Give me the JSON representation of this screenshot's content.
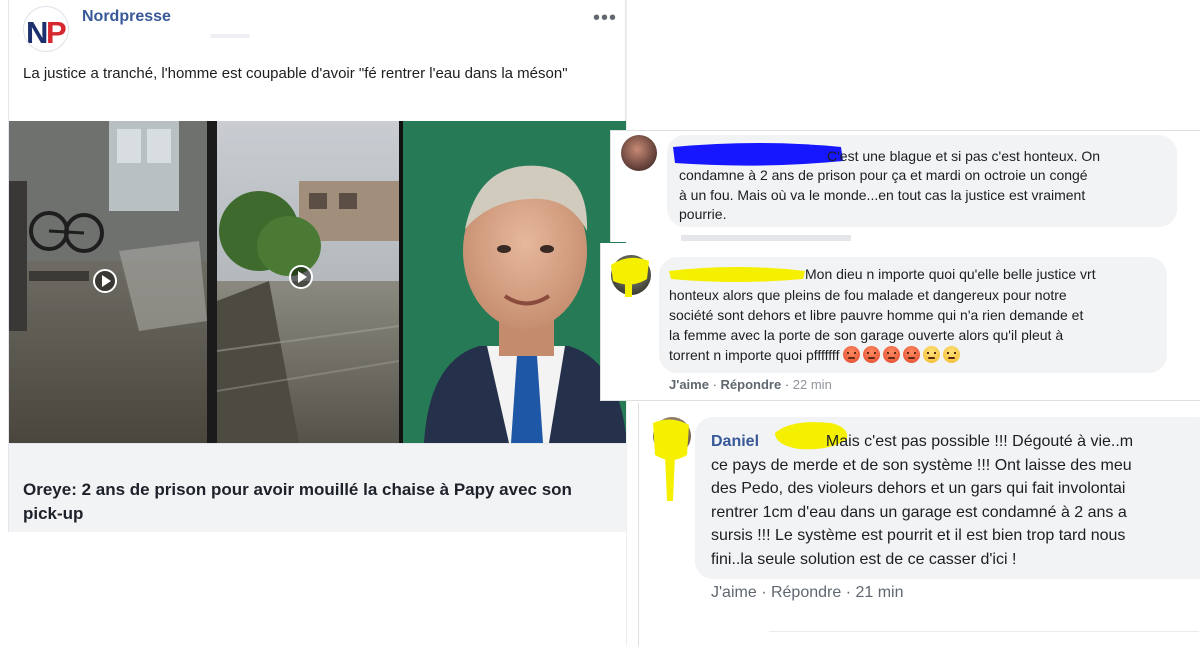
{
  "post": {
    "page_name": "Nordpresse",
    "logo_letters": "NP",
    "more_icon": "more-horizontal-icon",
    "text": "La justice a tranché, l'homme est coupable d'avoir \"fé rentrer l'eau dans la méson\"",
    "link_title": "Oreye: 2 ans de prison pour avoir mouillé la chaise à Papy avec son pick-up",
    "media": {
      "play_icon": "play-icon",
      "colors": {
        "brand_blue": "#1c2f6e",
        "brand_red": "#d7282f"
      }
    }
  },
  "comments": [
    {
      "text": "C'est une blague et si pas c'est honteux. On condamne à 2 ans de prison pour ça et mardi on octroie un congé à un fou. Mais où va le monde...en tout cas la justice est vraiment pourrie.",
      "line1": "C'est une blague et si pas c'est honteux. On",
      "line2": "condamne à 2 ans de prison pour ça et mardi on octroie un congé",
      "line3": "à un fou. Mais où va le monde...en tout cas la justice est vraiment",
      "line4": "pourrie.",
      "redaction_color": "#1717ff"
    },
    {
      "line1": "Mon dieu n importe quoi qu'elle belle justice vrt",
      "line2": "honteux alors que pleins de fou malade et dangereux pour notre",
      "line3": "société sont dehors et libre pauvre homme qui n'a rien demande et",
      "line4": "la femme avec la porte de son garage ouverte alors qu'il pleut à",
      "line5": "torrent n importe quoi pfffffff",
      "like": "J'aime",
      "reply": "Répondre",
      "time": "22 min",
      "reactions": [
        "angry",
        "angry",
        "angry",
        "angry",
        "annoyed",
        "annoyed"
      ],
      "redaction_color": "#f5f000"
    },
    {
      "name": "Daniel",
      "line1": "Mais c'est pas possible !!! Dégouté à vie..m",
      "line2": "ce pays de merde et de son système !!! Ont laisse des meu",
      "line3": "des Pedo, des violeurs dehors et un gars qui fait involontai",
      "line4": "rentrer 1cm d'eau dans un garage est condamné à 2 ans a",
      "line5": "sursis !!! Le système est pourrit et il est bien trop tard nous",
      "line6": "fini..la seule solution est de ce casser d'ici !",
      "like": "J'aime",
      "reply": "Répondre",
      "time": "21 min",
      "redaction_color": "#f5f000"
    }
  ]
}
